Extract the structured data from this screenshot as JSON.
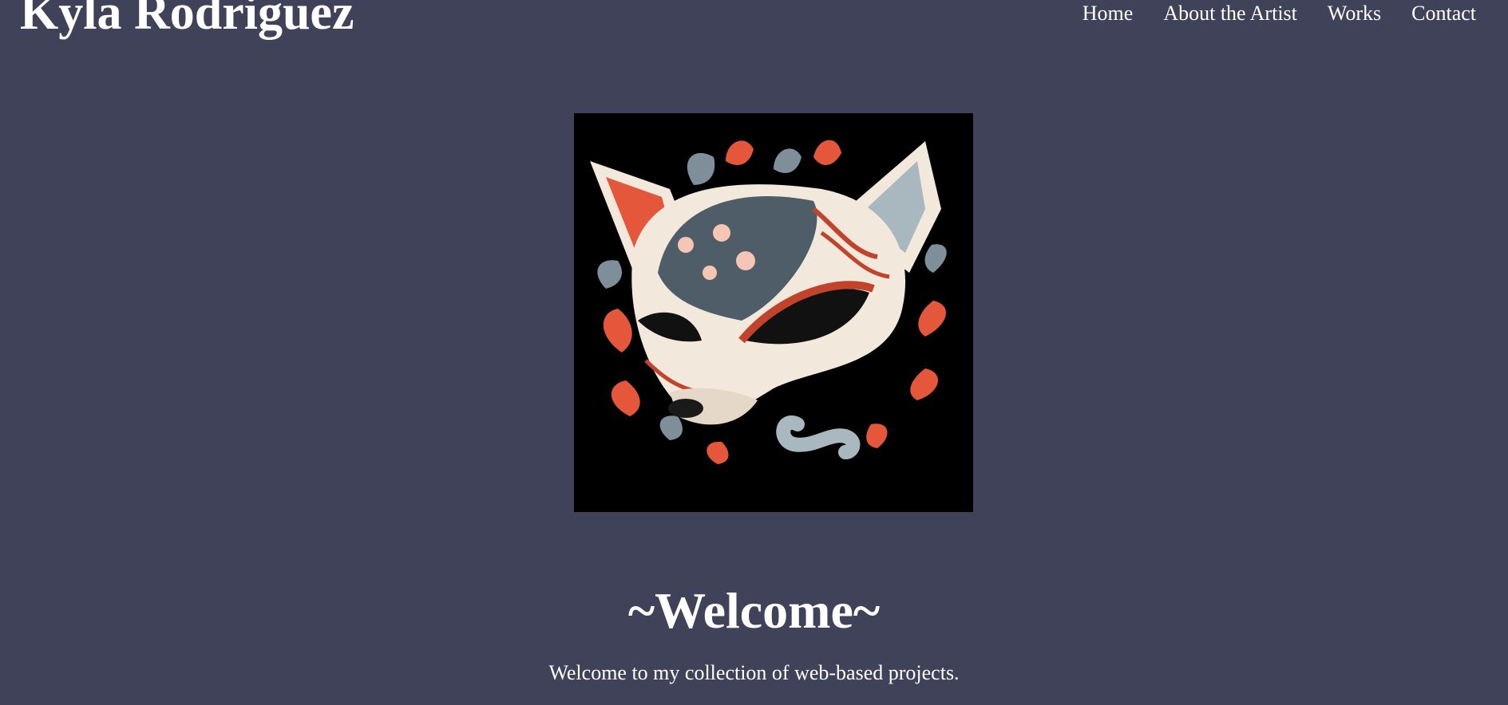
{
  "header": {
    "site_title": "Kyla Rodriguez",
    "nav": [
      {
        "label": "Home"
      },
      {
        "label": "About the Artist"
      },
      {
        "label": "Works"
      },
      {
        "label": "Contact"
      }
    ]
  },
  "hero": {
    "image_description": "kitsune-fox-mask-artwork",
    "welcome_title": "~Welcome~",
    "welcome_text": "Welcome to my collection of web-based projects."
  },
  "colors": {
    "background": "#404259",
    "text": "#ffffff",
    "image_bg": "#000000",
    "accent_orange": "#e4573a",
    "accent_slate": "#7e8f99",
    "cream": "#f3e8dc"
  }
}
